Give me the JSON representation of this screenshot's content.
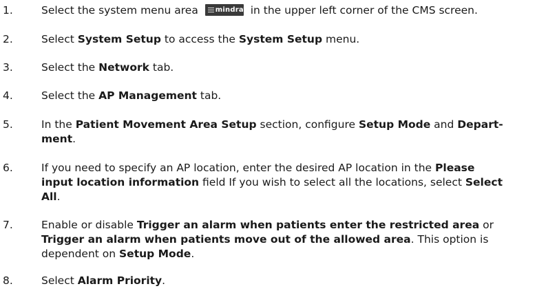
{
  "steps": [
    {
      "num": "1.",
      "parts": [
        {
          "t": "Select the system menu area "
        },
        {
          "logo": "mindray"
        },
        {
          "t": " in the upper left corner of the CMS screen."
        }
      ]
    },
    {
      "num": "2.",
      "parts": [
        {
          "t": "Select "
        },
        {
          "b": "System Setup"
        },
        {
          "t": " to access the "
        },
        {
          "b": "System Setup"
        },
        {
          "t": " menu."
        }
      ]
    },
    {
      "num": "3.",
      "parts": [
        {
          "t": "Select the "
        },
        {
          "b": "Network"
        },
        {
          "t": " tab."
        }
      ]
    },
    {
      "num": "4.",
      "parts": [
        {
          "t": "Select the "
        },
        {
          "b": "AP Management"
        },
        {
          "t": " tab."
        }
      ]
    },
    {
      "num": "5.",
      "parts": [
        {
          "t": "In the "
        },
        {
          "b": "Patient Movement Area Setup"
        },
        {
          "t": " section, configure "
        },
        {
          "b": "Setup Mode"
        },
        {
          "t": " and "
        },
        {
          "b": "Depart-"
        },
        {
          "br": true
        },
        {
          "b": "ment"
        },
        {
          "t": "."
        }
      ]
    },
    {
      "num": "6.",
      "parts": [
        {
          "t": "If you need to specify an AP location, enter the desired AP location in the "
        },
        {
          "b": "Please"
        },
        {
          "br": true
        },
        {
          "b": "input location information"
        },
        {
          "t": " field If you wish to select all the locations, select "
        },
        {
          "b": "Select"
        },
        {
          "br": true
        },
        {
          "b": "All"
        },
        {
          "t": "."
        }
      ]
    },
    {
      "num": "7.",
      "parts": [
        {
          "t": "Enable or disable "
        },
        {
          "b": "Trigger an alarm when patients enter the restricted area"
        },
        {
          "t": " or"
        },
        {
          "br": true
        },
        {
          "b": "Trigger an alarm when patients move out of the allowed area"
        },
        {
          "t": ". This option is"
        },
        {
          "br": true
        },
        {
          "t": "dependent on "
        },
        {
          "b": "Setup Mode"
        },
        {
          "t": "."
        }
      ]
    },
    {
      "num": "8.",
      "parts": [
        {
          "t": "Select "
        },
        {
          "b": "Alarm Priority"
        },
        {
          "t": "."
        }
      ]
    }
  ]
}
